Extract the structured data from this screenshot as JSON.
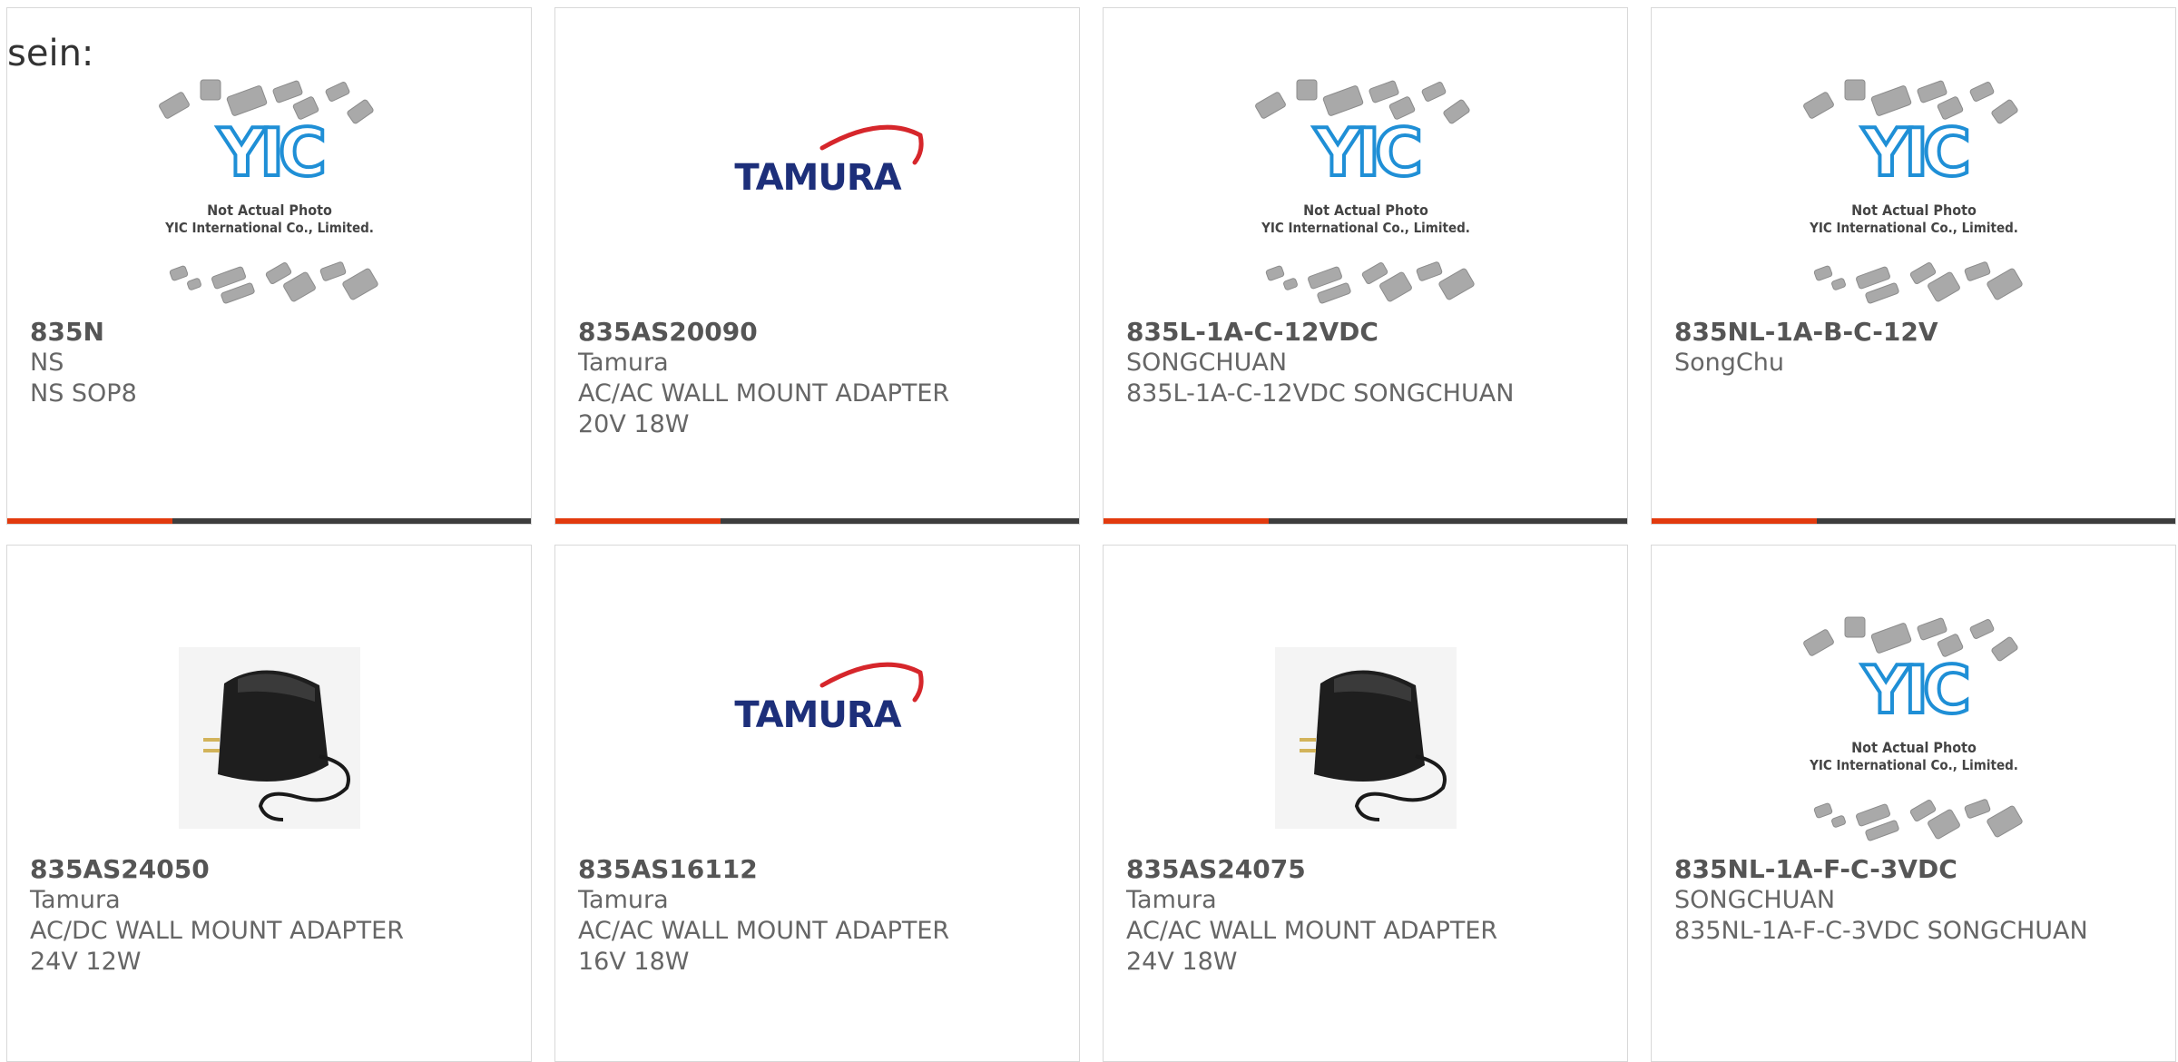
{
  "intro_text": "sein:",
  "products": [
    {
      "part_number": "835N",
      "lines": [
        "NS",
        "NS SOP8"
      ],
      "image": "yic-placeholder"
    },
    {
      "part_number": "835AS20090",
      "lines": [
        "Tamura",
        "AC/AC WALL MOUNT ADAPTER",
        "20V 18W"
      ],
      "image": "tamura-logo"
    },
    {
      "part_number": "835L-1A-C-12VDC",
      "lines": [
        "SONGCHUAN",
        "835L-1A-C-12VDC SONGCHUAN"
      ],
      "image": "yic-placeholder"
    },
    {
      "part_number": "835NL-1A-B-C-12V",
      "lines": [
        "SongChu"
      ],
      "image": "yic-placeholder"
    },
    {
      "part_number": "835AS24050",
      "lines": [
        "Tamura",
        "AC/DC WALL MOUNT ADAPTER",
        "24V 12W"
      ],
      "image": "wall-adapter-photo"
    },
    {
      "part_number": "835AS16112",
      "lines": [
        "Tamura",
        "AC/AC WALL MOUNT ADAPTER",
        "16V 18W"
      ],
      "image": "tamura-logo"
    },
    {
      "part_number": "835AS24075",
      "lines": [
        "Tamura",
        "AC/AC WALL MOUNT ADAPTER",
        "24V 18W"
      ],
      "image": "wall-adapter-photo"
    },
    {
      "part_number": "835NL-1A-F-C-3VDC",
      "lines": [
        "SONGCHUAN",
        "835NL-1A-F-C-3VDC SONGCHUAN"
      ],
      "image": "yic-placeholder"
    }
  ],
  "yic_placeholder": {
    "line1": "Not Actual Photo",
    "line2": "YIC International Co., Limited.",
    "logo": "YIC"
  },
  "tamura_logo_text": "TAMURA",
  "colors": {
    "accent": "#e23a0e",
    "bar": "#3d3d3d",
    "yic_blue": "#1f8fd6",
    "tamura_navy": "#1d2f7a",
    "tamura_red": "#d6262b"
  }
}
